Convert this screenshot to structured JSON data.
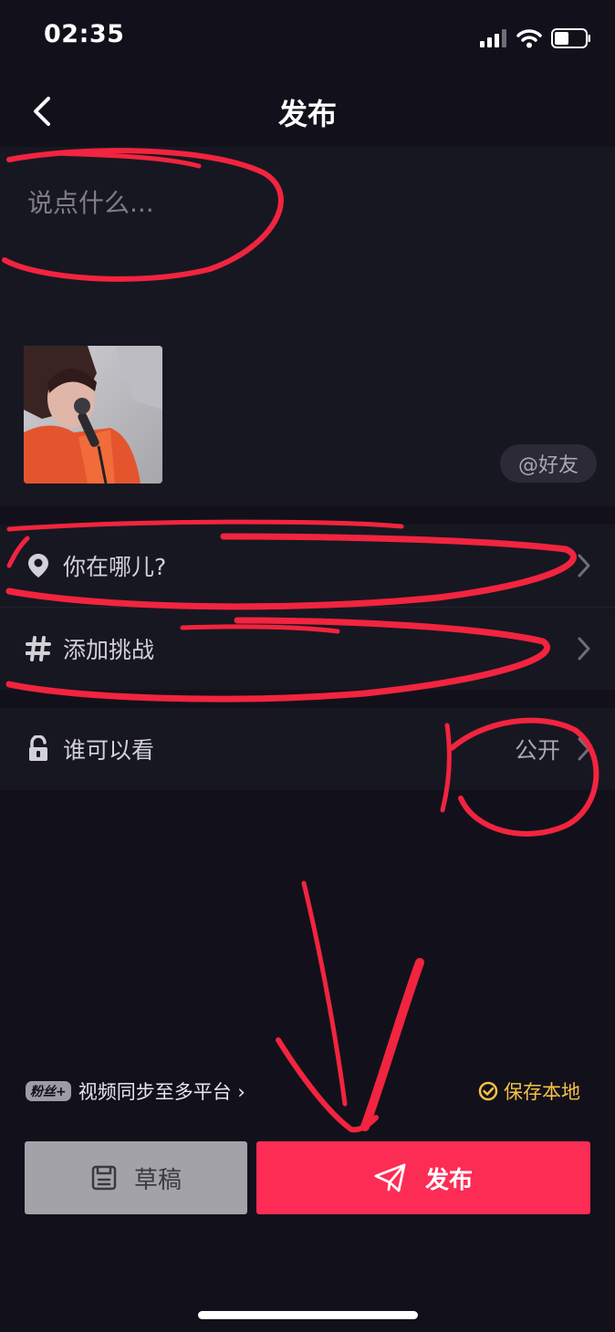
{
  "status_bar": {
    "time": "02:35"
  },
  "nav": {
    "title": "发布",
    "back_icon": "chevron-left-icon"
  },
  "caption": {
    "placeholder": "说点什么...",
    "mention_label": "@好友"
  },
  "location_row": {
    "label": "你在哪儿?",
    "icon": "location-pin-icon"
  },
  "challenge_row": {
    "label": "添加挑战",
    "icon": "hashtag-icon"
  },
  "privacy_row": {
    "label": "谁可以看",
    "value": "公开",
    "icon": "unlock-icon"
  },
  "bottom": {
    "fans_badge": "粉丝+",
    "sync_label": "视频同步至多平台 ›",
    "save_local_label": "保存本地",
    "draft_label": "草稿",
    "publish_label": "发布"
  },
  "colors": {
    "background": "#12111b",
    "panel": "#171722",
    "accent": "#fd2c55",
    "save_local": "#f5c243",
    "annotation": "#f2243f"
  }
}
